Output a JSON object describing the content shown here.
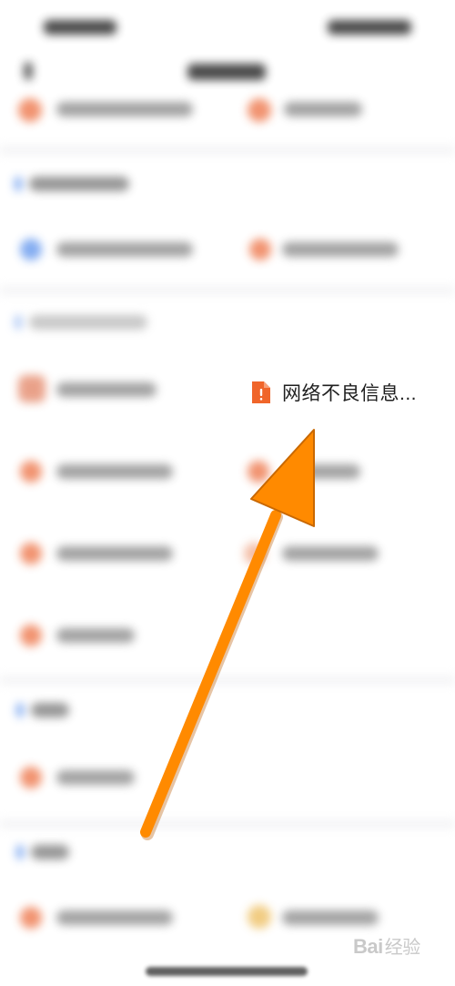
{
  "popup": {
    "label": "网络不良信息..."
  },
  "colors": {
    "accent_orange": "#f0652a",
    "arrow_orange": "#ff8a00",
    "blurred_icon_orange": "#f08a64",
    "blurred_icon_blue": "#7aa6f0",
    "blurred_icon_yellow": "#f0c878"
  },
  "icons": {
    "document_alert": "document-alert-icon",
    "annotation_arrow": "arrow-annotation"
  },
  "watermark": {
    "brand": "Bai",
    "sub": "经验"
  }
}
